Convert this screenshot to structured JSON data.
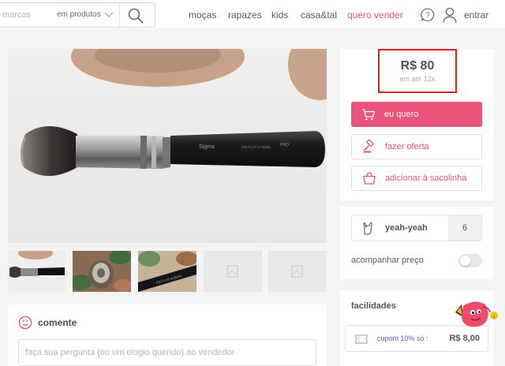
{
  "header": {
    "search_placeholder": "marcas",
    "search_scope": "em produtos",
    "nav": [
      "moças",
      "rapazes",
      "kids",
      "casa&tal",
      "quero vender"
    ],
    "login": "entrar"
  },
  "product": {
    "price": "R$ 80",
    "installments": "em até 12x",
    "buy_label": "eu quero",
    "offer_label": "fazer oferta",
    "bag_label": "adicionar à sacolinha",
    "yeah_label": "yeah-yeah",
    "yeah_count": "6",
    "watch_label": "acompanhar preço"
  },
  "facilities": {
    "title": "facilidades",
    "coupon_text": "cupom 10% só :",
    "coupon_value": "R$ 8,00"
  },
  "comments": {
    "title": "comente",
    "placeholder": "faça sua pergunta (ou um elogio querido) ao vendedor"
  },
  "colors": {
    "accent": "#e8547a",
    "highlight_border": "#e02020",
    "coupon_text": "#6a5acd"
  },
  "icons": [
    "search-icon",
    "chevron-down-icon",
    "help-icon",
    "user-icon",
    "cart-icon",
    "gavel-icon",
    "bag-icon",
    "rock-hand-icon",
    "coupon-icon",
    "smile-icon",
    "image-placeholder-icon"
  ]
}
